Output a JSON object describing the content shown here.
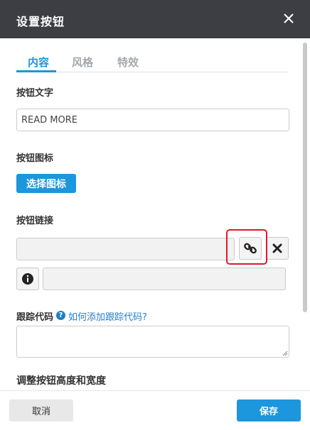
{
  "dialog": {
    "title": "设置按钮",
    "close_icon": "close-icon"
  },
  "tabs": [
    {
      "label": "内容",
      "active": true
    },
    {
      "label": "风格",
      "active": false
    },
    {
      "label": "特效",
      "active": false
    }
  ],
  "button_text": {
    "label": "按钮文字",
    "value": "READ MORE"
  },
  "button_icon": {
    "label": "按钮图标",
    "choose_label": "选择图标"
  },
  "button_link": {
    "label": "按钮链接",
    "url_value": "",
    "link_icon": "link-icon",
    "clear_icon": "close-x-icon",
    "info_icon": "info-icon",
    "info_value": ""
  },
  "tracking": {
    "label": "跟踪代码",
    "help_icon": "help-icon",
    "help_link": "如何添加跟踪代码?",
    "value": ""
  },
  "size_section": {
    "label": "调整按钮高度和宽度"
  },
  "footer": {
    "cancel_label": "取消",
    "save_label": "保存"
  },
  "colors": {
    "accent": "#1c96dc",
    "titlebar": "#3c3e43",
    "highlight": "#e0172b"
  }
}
